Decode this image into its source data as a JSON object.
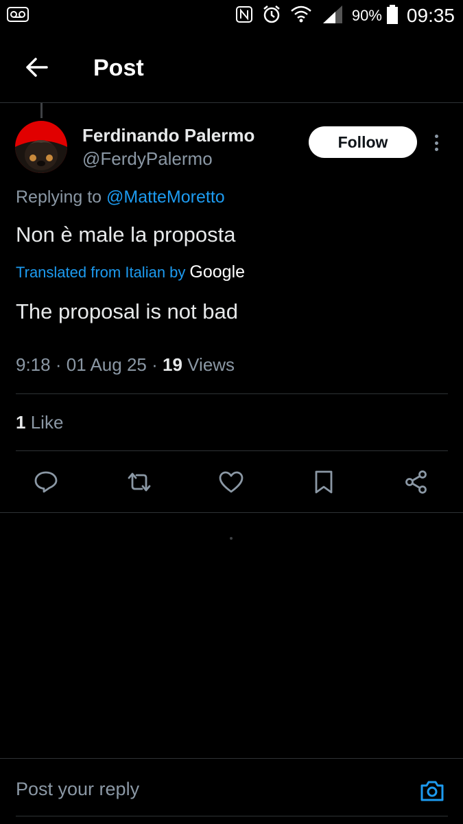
{
  "status_bar": {
    "time": "09:35",
    "battery_percent": "90%",
    "icons": [
      "voicemail-icon",
      "nfc-icon",
      "alarm-icon",
      "wifi-icon",
      "signal-icon",
      "battery-icon"
    ]
  },
  "header": {
    "title": "Post",
    "back_icon": "arrow-left-icon"
  },
  "post": {
    "author": {
      "name": "Ferdinando Palermo",
      "handle": "@FerdyPalermo"
    },
    "follow_label": "Follow",
    "replying_prefix": "Replying to",
    "replying_to": "@MatteMoretto",
    "text": "Non è male la proposta",
    "translated_label": "Translated from Italian by",
    "translator": "Google",
    "translation": "The proposal is not bad",
    "time": "9:18",
    "date": "01 Aug 25",
    "views_count": "19",
    "views_label": "Views",
    "likes_count": "1",
    "likes_label": "Like"
  },
  "actions": [
    "reply-icon",
    "repost-icon",
    "like-icon",
    "bookmark-icon",
    "share-icon"
  ],
  "composer": {
    "placeholder": "Post your reply"
  },
  "colors": {
    "background": "#000000",
    "accent": "#1d9bf0",
    "secondary_text": "#8b98a5",
    "divider": "#2f3336"
  }
}
